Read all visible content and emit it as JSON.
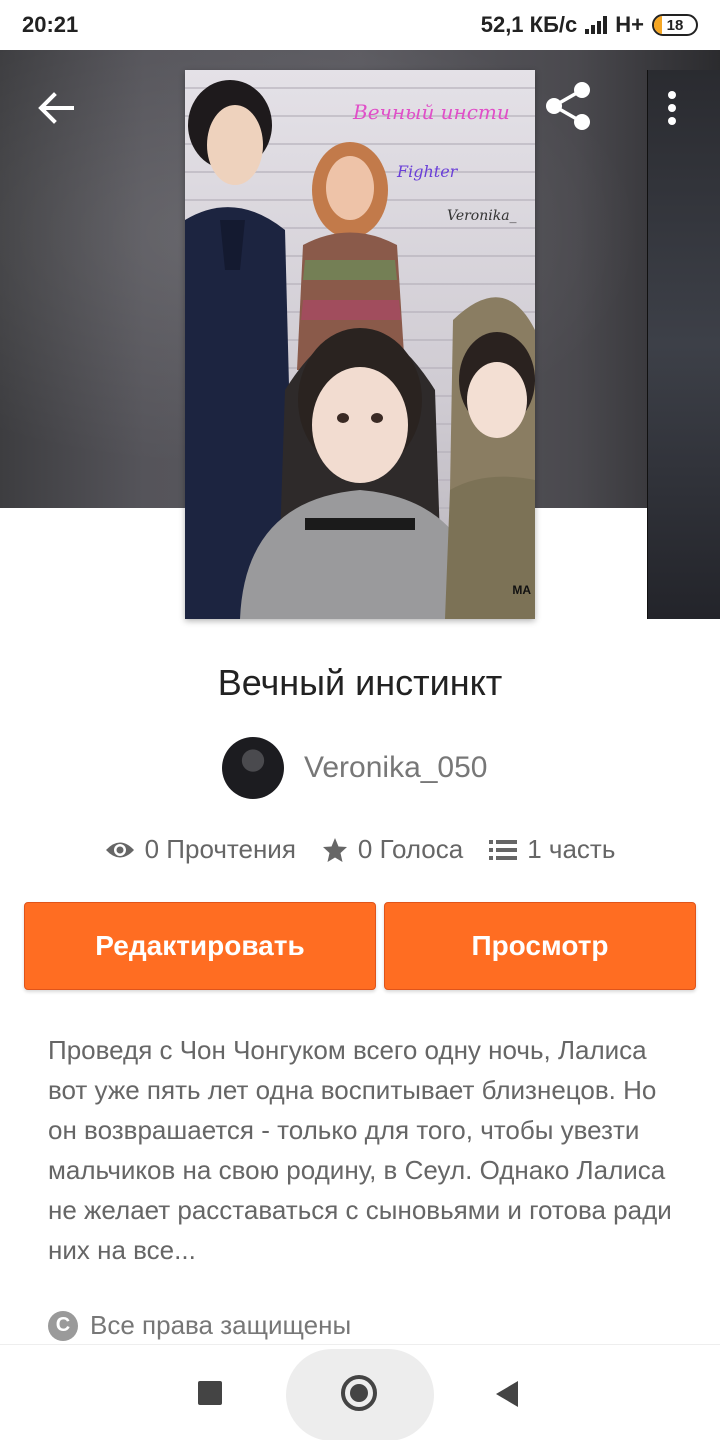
{
  "status_bar": {
    "time": "20:21",
    "network_speed": "52,1 КБ/с",
    "network_type": "H+",
    "battery": "18",
    "battery_level": 0.18
  },
  "header": {
    "back_icon": "arrow-left-icon",
    "share_icon": "share-icon",
    "more_icon": "more-vertical-icon"
  },
  "cover": {
    "title_text": "Вечный инсти",
    "subtitle_text": "Fighter",
    "author_text": "Veronika_",
    "mark_text": "MA"
  },
  "story": {
    "title": "Вечный инстинкт",
    "author": "Veronika_050"
  },
  "stats": {
    "reads": "0 Прочтения",
    "votes": "0 Голоса",
    "parts": "1 часть"
  },
  "buttons": {
    "edit": "Редактировать",
    "view": "Просмотр"
  },
  "description": "Проведя с  Чон Чонгуком всего одну ночь, Лалиса вот уже пять лет одна воспитывает близнецов. Но он возврашается - только для того, чтобы увезти мальчиков на свою родину, в Сеул. Однако Лалиса не желает расставаться с сыновьями и готова ради них на все...",
  "rights": {
    "icon_glyph": "C",
    "label": "Все права защищены"
  },
  "colors": {
    "accent": "#ff6d22",
    "text_muted": "#666666"
  }
}
